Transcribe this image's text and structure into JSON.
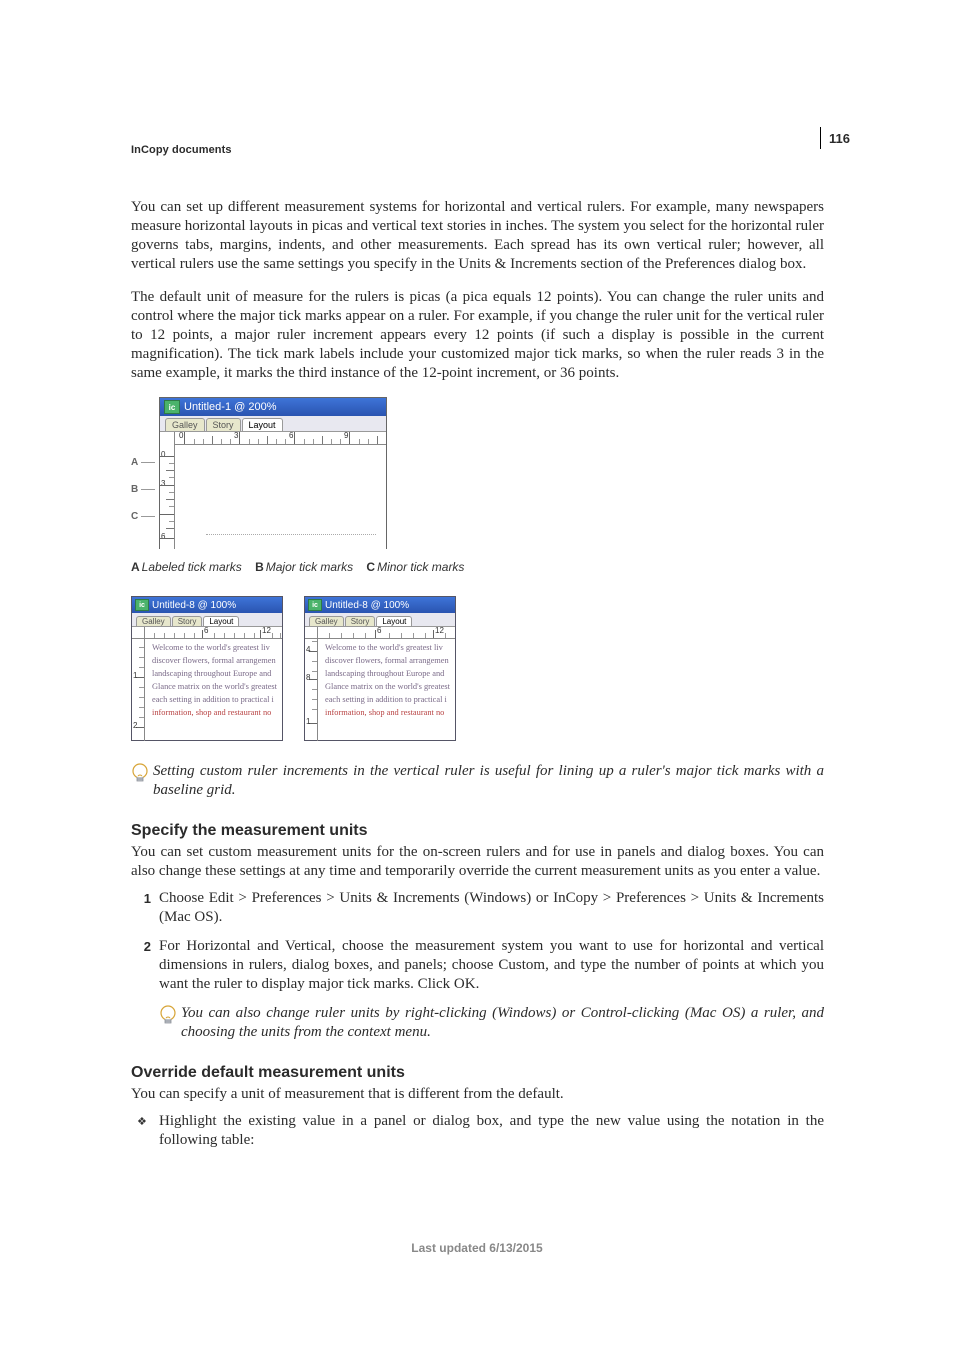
{
  "page_number": "116",
  "running_head": "InCopy documents",
  "para1": "You can set up different measurement systems for horizontal and vertical rulers. For example, many newspapers measure horizontal layouts in picas and vertical text stories in inches. The system you select for the horizontal ruler governs tabs, margins, indents, and other measurements. Each spread has its own vertical ruler; however, all vertical rulers use the same settings you specify in the Units & Increments section of the Preferences dialog box.",
  "para2": "The default unit of measure for the rulers is picas (a pica equals 12 points). You can change the ruler units and control where the major tick marks appear on a ruler. For example, if you change the ruler unit for the vertical ruler to 12 points, a major ruler increment appears every 12 points (if such a display is possible in the current magnification). The tick mark labels include your customized major tick marks, so when the ruler reads 3 in the same example, it marks the third instance of the 12-point increment, or 36 points.",
  "fig1": {
    "window_title": "Untitled-1 @ 200%",
    "tabs": [
      "Galley",
      "Story",
      "Layout"
    ],
    "h_numbers": [
      "0",
      "3",
      "6",
      "9"
    ],
    "v_numbers": [
      "0",
      "3",
      "6"
    ],
    "labels": {
      "A": "A",
      "B": "B",
      "C": "C"
    },
    "caption_A": "Labeled tick marks",
    "caption_B": "Major tick marks",
    "caption_C": "Minor tick marks"
  },
  "fig2": {
    "window_title": "Untitled-8 @ 100%",
    "tabs": [
      "Galley",
      "Story",
      "Layout"
    ],
    "left_h": [
      "6",
      "12"
    ],
    "left_v": [
      "1",
      "2"
    ],
    "right_h": [
      "6",
      "12"
    ],
    "right_v": [
      "4",
      "8",
      "1"
    ],
    "sample_lines": [
      "Welcome to the world's greatest liv",
      "discover flowers, formal arrangemen",
      "landscaping throughout Europe and",
      "Glance matrix on the world's greatest",
      "each setting in addition to practical i",
      "information, shop and restaurant no"
    ]
  },
  "tip_fig2": "Setting custom ruler increments in the vertical ruler is useful for lining up a ruler's major tick marks with a baseline grid.",
  "section1": {
    "heading": "Specify the measurement units",
    "intro": "You can set custom measurement units for the on-screen rulers and for use in panels and dialog boxes. You can also change these settings at any time and temporarily override the current measurement units as you enter a value.",
    "steps": [
      "Choose Edit > Preferences > Units & Increments (Windows) or InCopy > Preferences > Units & Increments (Mac OS).",
      "For Horizontal and Vertical, choose the measurement system you want to use for horizontal and vertical dimensions in rulers, dialog boxes, and panels; choose Custom, and type the number of points at which you want the ruler to display major tick marks. Click OK."
    ],
    "tip": "You can also change ruler units by right-clicking (Windows) or Control-clicking (Mac OS) a ruler, and choosing the units from the context menu."
  },
  "section2": {
    "heading": "Override default measurement units",
    "intro": "You can specify a unit of measurement that is different from the default.",
    "bullet": "Highlight the existing value in a panel or dialog box, and type the new value using the notation in the following table:"
  },
  "footer": "Last updated 6/13/2015"
}
